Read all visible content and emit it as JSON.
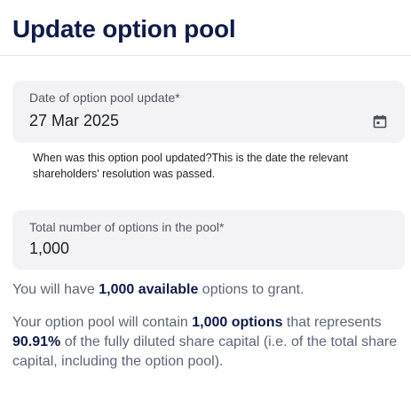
{
  "header": {
    "title": "Update option pool"
  },
  "date_field": {
    "label": "Date of option pool update*",
    "value": "27 Mar 2025",
    "icon": "calendar-icon",
    "helper": "When was this option pool updated?This is the date the relevant shareholders' resolution was passed."
  },
  "total_field": {
    "label": "Total number of options in the pool*",
    "value": "1,000"
  },
  "available": {
    "prefix": "You will have ",
    "highlight": "1,000 available",
    "suffix": " options to grant."
  },
  "summary": {
    "prefix": "Your option pool will contain ",
    "highlight_options": "1,000 options",
    "middle": " that represents ",
    "highlight_percent": "90.91%",
    "suffix": " of the fully diluted share capital (i.e. of the total share capital, including the option pool)."
  },
  "colors": {
    "title": "#0f1b4a",
    "field_bg": "#f3f3f5",
    "muted_text": "#5e6479"
  }
}
